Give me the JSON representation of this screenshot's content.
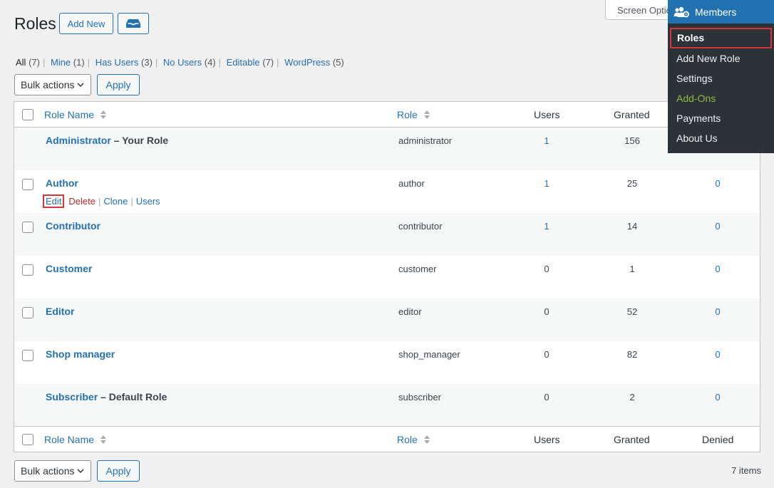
{
  "header": {
    "title": "Roles",
    "add_new": "Add New",
    "screen_options": "Screen Options"
  },
  "filters": [
    {
      "label": "All",
      "count": "(7)",
      "current": true
    },
    {
      "label": "Mine",
      "count": "(1)"
    },
    {
      "label": "Has Users",
      "count": "(3)"
    },
    {
      "label": "No Users",
      "count": "(4)"
    },
    {
      "label": "Editable",
      "count": "(7)"
    },
    {
      "label": "WordPress",
      "count": "(5)"
    }
  ],
  "bulk": {
    "select_label": "Bulk actions",
    "apply_label": "Apply"
  },
  "table": {
    "columns": {
      "role_name": "Role Name",
      "role": "Role",
      "users": "Users",
      "granted": "Granted",
      "denied": "Denied"
    },
    "rows": [
      {
        "name": "Administrator",
        "suffix": " – Your Role",
        "slug": "administrator",
        "users": "1",
        "granted": "156",
        "denied": "",
        "checkbox": false,
        "users_link": true
      },
      {
        "name": "Author",
        "suffix": "",
        "slug": "author",
        "users": "1",
        "granted": "25",
        "denied": "0",
        "checkbox": true,
        "users_link": true,
        "actions": [
          "Edit",
          "Delete",
          "Clone",
          "Users"
        ]
      },
      {
        "name": "Contributor",
        "suffix": "",
        "slug": "contributor",
        "users": "1",
        "granted": "14",
        "denied": "0",
        "checkbox": true,
        "users_link": true
      },
      {
        "name": "Customer",
        "suffix": "",
        "slug": "customer",
        "users": "0",
        "granted": "1",
        "denied": "0",
        "checkbox": true,
        "users_link": false
      },
      {
        "name": "Editor",
        "suffix": "",
        "slug": "editor",
        "users": "0",
        "granted": "52",
        "denied": "0",
        "checkbox": true,
        "users_link": false
      },
      {
        "name": "Shop manager",
        "suffix": "",
        "slug": "shop_manager",
        "users": "0",
        "granted": "82",
        "denied": "0",
        "checkbox": true,
        "users_link": false
      },
      {
        "name": "Subscriber",
        "suffix": " – Default Role",
        "slug": "subscriber",
        "users": "0",
        "granted": "2",
        "denied": "0",
        "checkbox": false,
        "users_link": false
      }
    ]
  },
  "items_count": "7 items",
  "flyout": {
    "title": "Members",
    "items": [
      "Roles",
      "Add New Role",
      "Settings",
      "Add-Ons",
      "Payments",
      "About Us"
    ]
  },
  "colors": {
    "accent": "#2271b1",
    "danger": "#d63638",
    "menu_bg": "#2c3338",
    "addons": "#8dbb3c"
  }
}
